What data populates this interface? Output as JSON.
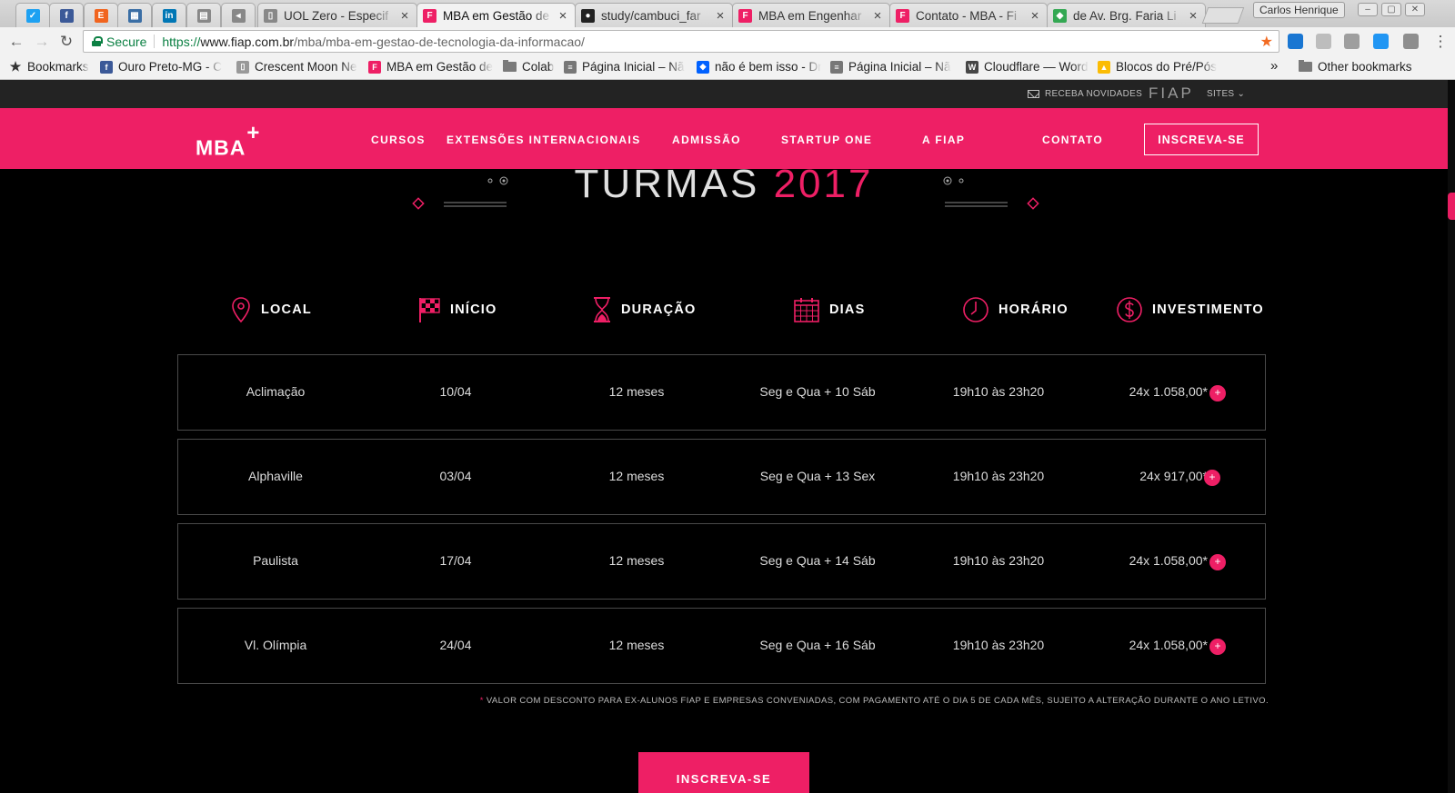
{
  "browser": {
    "tabs": [
      {
        "title": "",
        "icon": "bird-icon",
        "color": "#1da1f2",
        "pinned": true
      },
      {
        "title": "",
        "icon": "facebook-icon",
        "color": "#3b5998",
        "pinned": true
      },
      {
        "title": "",
        "icon": "etsy-icon",
        "color": "#f1641e",
        "pinned": true
      },
      {
        "title": "",
        "icon": "calendar-icon",
        "color": "#3a6ea5",
        "pinned": true
      },
      {
        "title": "",
        "icon": "linkedin-icon",
        "color": "#0077b5",
        "pinned": true
      },
      {
        "title": "",
        "icon": "spreadsheet-icon",
        "color": "#888888",
        "pinned": true
      },
      {
        "title": "",
        "icon": "speaker-icon",
        "color": "#888888",
        "pinned": true
      },
      {
        "title": "UOL Zero - Especif",
        "icon": "document-icon",
        "color": "#888888"
      },
      {
        "title": "MBA em Gestão de",
        "icon": "fiap-icon",
        "color": "#ee1f65",
        "active": true
      },
      {
        "title": "study/cambuci_far",
        "icon": "github-icon",
        "color": "#222222"
      },
      {
        "title": "MBA em Engenhar",
        "icon": "fiap-icon",
        "color": "#ee1f65"
      },
      {
        "title": "Contato - MBA - Fi",
        "icon": "fiap-icon",
        "color": "#ee1f65"
      },
      {
        "title": "de Av. Brg. Faria Li",
        "icon": "maps-icon",
        "color": "#34a853"
      }
    ],
    "profile_name": "Carlos Henrique",
    "secure_label": "Secure",
    "url_protocol": "https://",
    "url_host": "www.fiap.com.br",
    "url_path": "/mba/mba-em-gestao-de-tecnologia-da-informacao/",
    "bookmarks": [
      {
        "label": "Bookmarks",
        "icon": "star-icon",
        "color": "#333333"
      },
      {
        "label": "Ouro Preto-MG - C",
        "icon": "facebook-icon",
        "color": "#3b5998"
      },
      {
        "label": "Crescent Moon Ne",
        "icon": "page-icon",
        "color": "#999999"
      },
      {
        "label": "MBA em Gestão de",
        "icon": "fiap-icon",
        "color": "#ee1f65"
      },
      {
        "label": "Colab",
        "icon": "folder-icon",
        "color": "#7a7a7a"
      },
      {
        "label": "Página Inicial – Nã",
        "icon": "site-icon",
        "color": "#777777"
      },
      {
        "label": "não é bem isso - Dr",
        "icon": "dropbox-icon",
        "color": "#0061ff"
      },
      {
        "label": "Página Inicial – Nã",
        "icon": "site-icon",
        "color": "#777777"
      },
      {
        "label": "Cloudflare — Word",
        "icon": "wordpress-icon",
        "color": "#464646"
      },
      {
        "label": "Blocos do Pré/Pós",
        "icon": "drive-icon",
        "color": "#fbbc04"
      }
    ],
    "bookmarks_overflow": "»",
    "other_bookmarks": "Other bookmarks"
  },
  "site": {
    "util": {
      "newsletter": "RECEBA NOVIDADES",
      "brand": "FIAP",
      "sites": "SITES"
    },
    "logo": "MBA",
    "logo_plus": "+",
    "nav": [
      "CURSOS",
      "EXTENSÕES INTERNACIONAIS",
      "ADMISSÃO",
      "STARTUP ONE",
      "A FIAP",
      "CONTATO"
    ],
    "nav_cta": "INSCREVA-SE",
    "heading_word": "TURMAS",
    "heading_year": "2017",
    "columns": [
      {
        "label": "LOCAL",
        "icon": "location-pin-icon"
      },
      {
        "label": "INÍCIO",
        "icon": "checkered-flag-icon"
      },
      {
        "label": "DURAÇÃO",
        "icon": "hourglass-icon"
      },
      {
        "label": "DIAS",
        "icon": "calendar-icon"
      },
      {
        "label": "HORÁRIO",
        "icon": "clock-icon"
      },
      {
        "label": "INVESTIMENTO",
        "icon": "dollar-icon"
      }
    ],
    "rows": [
      {
        "local": "Aclimação",
        "inicio": "10/04",
        "duracao": "12 meses",
        "dias": "Seg e Qua + 10 Sáb",
        "horario": "19h10 às 23h20",
        "investimento": "24x 1.058,00*"
      },
      {
        "local": "Alphaville",
        "inicio": "03/04",
        "duracao": "12 meses",
        "dias": "Seg e Qua + 13 Sex",
        "horario": "19h10 às 23h20",
        "investimento": "24x 917,00*"
      },
      {
        "local": "Paulista",
        "inicio": "17/04",
        "duracao": "12 meses",
        "dias": "Seg e Qua + 14 Sáb",
        "horario": "19h10 às 23h20",
        "investimento": "24x 1.058,00*"
      },
      {
        "local": "Vl. Olímpia",
        "inicio": "24/04",
        "duracao": "12 meses",
        "dias": "Seg e Qua + 16 Sáb",
        "horario": "19h10 às 23h20",
        "investimento": "24x 1.058,00*"
      }
    ],
    "plus_symbol": "+",
    "footnote_mark": "*",
    "footnote": " VALOR COM DESCONTO PARA EX-ALUNOS FIAP E EMPRESAS CONVENIADAS, COM PAGAMENTO ATÉ O DIA 5 DE CADA MÊS, SUJEITO A ALTERAÇÃO DURANTE O ANO LETIVO.",
    "bottom_cta": "INSCREVA-SE",
    "accent": "#ee1f65"
  }
}
